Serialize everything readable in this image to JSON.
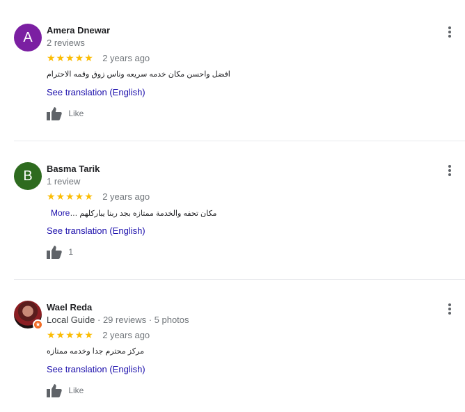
{
  "reviews": [
    {
      "avatar_letter": "A",
      "avatar_color": "#7b1fa2",
      "name": "Amera Dnewar",
      "meta": "2 reviews",
      "stars": "★★★★★",
      "date": "2 years ago",
      "text": "افضل واحسن مكان خدمه سريعه  وناس زوق وقمه الاحترام",
      "translation": "See translation (English)",
      "like": "Like"
    },
    {
      "avatar_letter": "B",
      "avatar_color": "#2e6b1f",
      "name": "Basma Tarik",
      "meta": "1 review",
      "stars": "★★★★★",
      "date": "2 years ago",
      "text": "مكان تحفه والخدمة ممتازه بجد ربنا يباركلهم …",
      "more": "More",
      "translation": "See translation (English)",
      "like": "1"
    },
    {
      "name": "Wael Reda",
      "guide": "Local Guide",
      "meta": "· 29 reviews · 5 photos",
      "stars": "★★★★★",
      "date": "2 years ago",
      "text": "مركز محترم جدا وخدمه ممتازه",
      "translation": "See translation (English)",
      "like": "Like"
    }
  ],
  "icons": {
    "thumbs_up": "thumbs-up-icon",
    "menu": "more-vert-icon",
    "local_guide": "star-badge-icon"
  },
  "colors": {
    "star": "#fbbc04",
    "link": "#1a0dab"
  }
}
